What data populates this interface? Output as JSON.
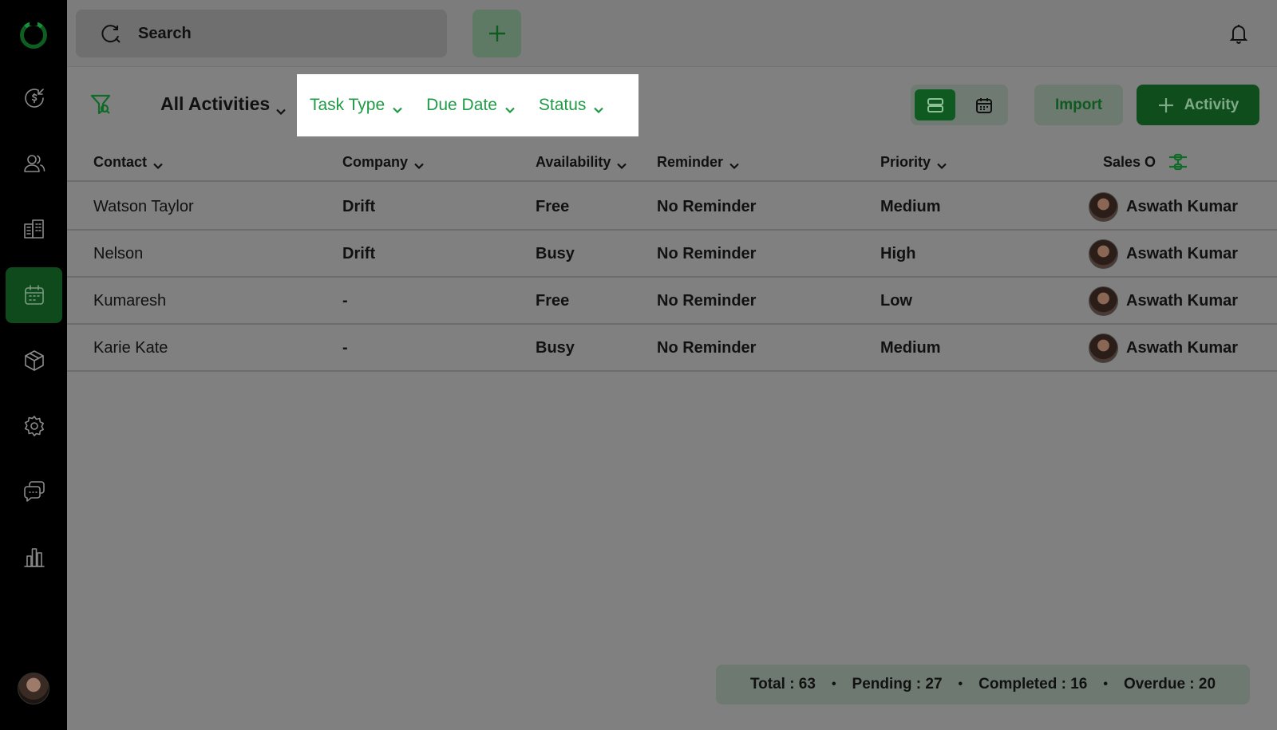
{
  "search": {
    "placeholder": "Search"
  },
  "filters": {
    "view_label": "All Activities",
    "chips": [
      "Task Type",
      "Due Date",
      "Status"
    ]
  },
  "actions": {
    "import_label": "Import",
    "add_activity_label": "Activity"
  },
  "table": {
    "columns": [
      "Contact",
      "Company",
      "Availability",
      "Reminder",
      "Priority",
      "Sales O"
    ],
    "rows": [
      {
        "contact": "Watson Taylor",
        "company": "Drift",
        "availability": "Free",
        "reminder": "No Reminder",
        "priority": "Medium",
        "owner": "Aswath Kumar"
      },
      {
        "contact": "Nelson",
        "company": "Drift",
        "availability": "Busy",
        "reminder": "No Reminder",
        "priority": "High",
        "owner": "Aswath Kumar"
      },
      {
        "contact": "Kumaresh",
        "company": "-",
        "availability": "Free",
        "reminder": "No Reminder",
        "priority": "Low",
        "owner": "Aswath Kumar"
      },
      {
        "contact": "Karie Kate",
        "company": "-",
        "availability": "Busy",
        "reminder": "No Reminder",
        "priority": "Medium",
        "owner": "Aswath Kumar"
      }
    ]
  },
  "stats": {
    "total": "Total : 63",
    "pending": "Pending : 27",
    "completed": "Completed : 16",
    "overdue": "Overdue : 20",
    "separator": "•"
  },
  "colors": {
    "accent": "#1e9b45",
    "dark_green": "#0f4d1d",
    "sidebar": "#000000",
    "overlay": "#808080"
  },
  "sidebar": {
    "icons": [
      "logo-icon",
      "deals-icon",
      "contacts-icon",
      "companies-icon",
      "activities-icon",
      "products-icon",
      "settings-icon",
      "chat-icon",
      "reports-icon"
    ],
    "active": "activities-icon"
  }
}
